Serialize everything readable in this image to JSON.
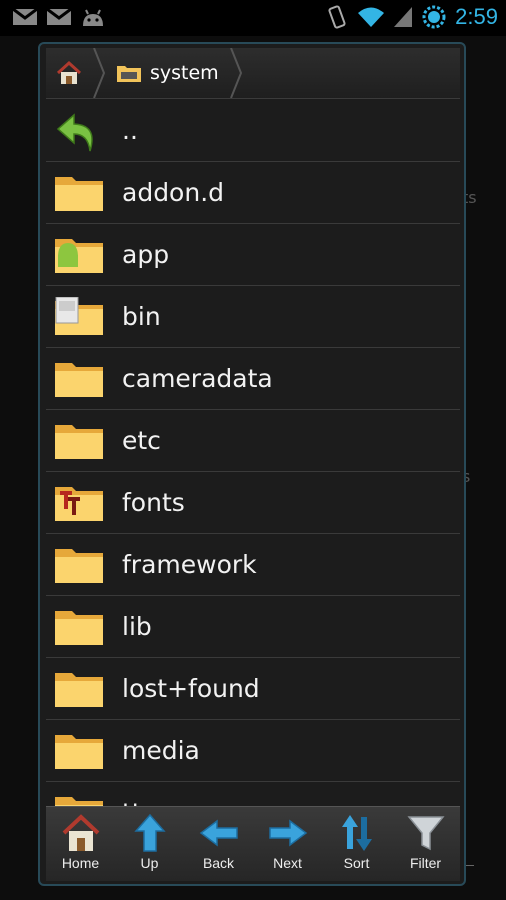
{
  "status_bar": {
    "time": "2:59",
    "icons": [
      "gmail-icon",
      "gmail-icon",
      "android-icon",
      "vibrate-icon",
      "wifi-icon",
      "signal-icon",
      "battery-icon"
    ],
    "accent": "#33b5e5"
  },
  "background_hints": {
    "text_a": "ts",
    "text_b": "s"
  },
  "path": {
    "crumbs": [
      {
        "label": "",
        "icon": "home-icon"
      },
      {
        "label": "system",
        "icon": "folder-drive-icon"
      }
    ]
  },
  "files": [
    {
      "name": "..",
      "icon": "up-arrow-icon"
    },
    {
      "name": "addon.d",
      "icon": "folder-icon"
    },
    {
      "name": "app",
      "icon": "folder-android-icon"
    },
    {
      "name": "bin",
      "icon": "folder-terminal-icon"
    },
    {
      "name": "cameradata",
      "icon": "folder-icon"
    },
    {
      "name": "etc",
      "icon": "folder-icon"
    },
    {
      "name": "fonts",
      "icon": "folder-fonts-icon"
    },
    {
      "name": "framework",
      "icon": "folder-icon"
    },
    {
      "name": "lib",
      "icon": "folder-icon"
    },
    {
      "name": "lost+found",
      "icon": "folder-icon"
    },
    {
      "name": "media",
      "icon": "folder-icon"
    },
    {
      "name": "tts",
      "icon": "folder-icon"
    }
  ],
  "toolbar": {
    "home": "Home",
    "up": "Up",
    "back": "Back",
    "next": "Next",
    "sort": "Sort",
    "filter": "Filter"
  }
}
